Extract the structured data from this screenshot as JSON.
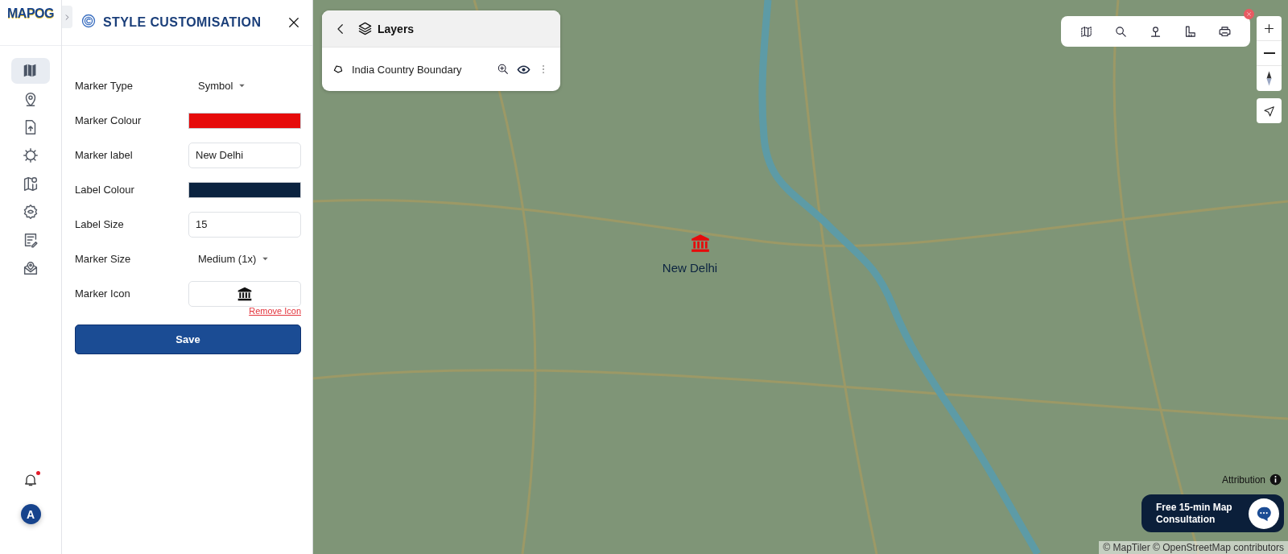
{
  "rail": {
    "logo": "MAPOG",
    "items": [
      {
        "kind": "map",
        "selected": true
      },
      {
        "kind": "pin",
        "selected": false
      },
      {
        "kind": "upload",
        "selected": false
      },
      {
        "kind": "sprocket",
        "selected": false
      },
      {
        "kind": "mapmark",
        "selected": false
      },
      {
        "kind": "settings",
        "selected": false
      },
      {
        "kind": "listedit",
        "selected": false
      },
      {
        "kind": "pinmail",
        "selected": false
      }
    ],
    "notification": {
      "unread": true
    },
    "avatar": "A"
  },
  "panel": {
    "title": "STYLE CUSTOMISATION",
    "fields": [
      {
        "kind": "select",
        "label": "Marker Type",
        "value": "Symbol"
      },
      {
        "kind": "color",
        "label": "Marker Colour",
        "color": "#e60b0b"
      },
      {
        "kind": "text",
        "label": "Marker label",
        "value": "New Delhi"
      },
      {
        "kind": "color",
        "label": "Label Colour",
        "color": "#0b2340"
      },
      {
        "kind": "text",
        "label": "Label Size",
        "value": "15"
      },
      {
        "kind": "select",
        "label": "Marker Size",
        "value": "Medium (1x)"
      },
      {
        "kind": "icon",
        "label": "Marker Icon"
      }
    ],
    "remove_link": "Remove Icon",
    "save": "Save"
  },
  "layers": {
    "title": "Layers",
    "items": [
      {
        "name": "India Country Boundary"
      }
    ]
  },
  "map": {
    "marker": {
      "label": "New Delhi"
    },
    "attribution": "Attribution",
    "consultation": "Free 15-min Map Consultation",
    "copyright": "© MapTiler © OpenStreetMap contributors"
  }
}
